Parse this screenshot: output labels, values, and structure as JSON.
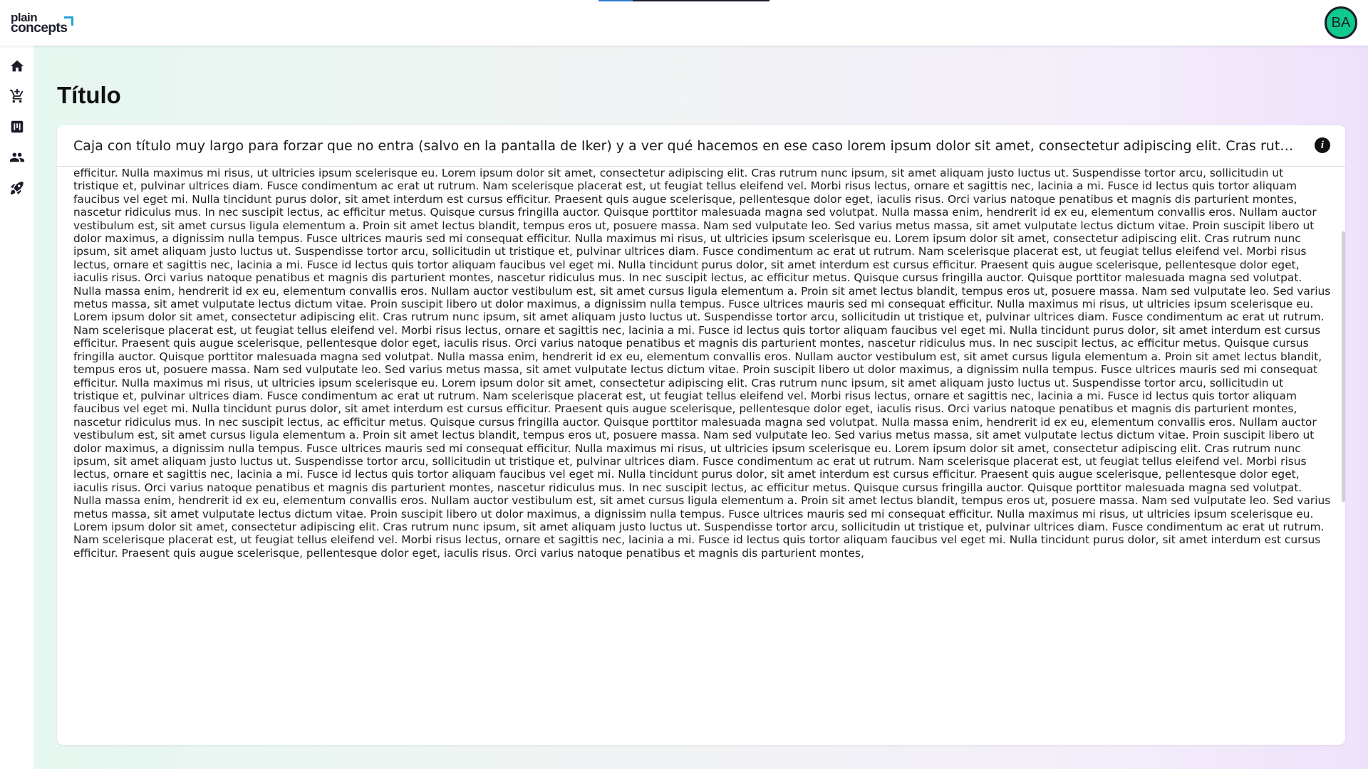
{
  "app": {
    "logo_line1": "plain",
    "logo_line2": "concepts",
    "user_initials": "BA",
    "accent_color": "#10c98c"
  },
  "sidebar": {
    "items": [
      {
        "icon": "home-icon"
      },
      {
        "icon": "cart-add-icon"
      },
      {
        "icon": "board-icon"
      },
      {
        "icon": "people-icon"
      },
      {
        "icon": "rocket-icon"
      }
    ]
  },
  "page": {
    "title": "Título"
  },
  "card": {
    "title": "Caja con título muy largo para forzar que no entra (salvo en la pantalla de Iker) y a ver qué hacemos en ese caso lorem ipsum dolor sit amet, consectetur adipiscing elit. Cras rutrum nunc ipsum, sit amet aliquam justo luctus ut.",
    "info_icon": "info-icon",
    "body": "efficitur. Nulla maximus mi risus, ut ultricies ipsum scelerisque eu. Lorem ipsum dolor sit amet, consectetur adipiscing elit. Cras rutrum nunc ipsum, sit amet aliquam justo luctus ut. Suspendisse tortor arcu, sollicitudin ut tristique et, pulvinar ultrices diam. Fusce condimentum ac erat ut rutrum. Nam scelerisque placerat est, ut feugiat tellus eleifend vel. Morbi risus lectus, ornare et sagittis nec, lacinia a mi. Fusce id lectus quis tortor aliquam faucibus vel eget mi. Nulla tincidunt purus dolor, sit amet interdum est cursus efficitur. Praesent quis augue scelerisque, pellentesque dolor eget, iaculis risus. Orci varius natoque penatibus et magnis dis parturient montes, nascetur ridiculus mus. In nec suscipit lectus, ac efficitur metus. Quisque cursus fringilla auctor. Quisque porttitor malesuada magna sed volutpat. Nulla massa enim, hendrerit id ex eu, elementum convallis eros. Nullam auctor vestibulum est, sit amet cursus ligula elementum a. Proin sit amet lectus blandit, tempus eros ut, posuere massa. Nam sed vulputate leo. Sed varius metus massa, sit amet vulputate lectus dictum vitae. Proin suscipit libero ut dolor maximus, a dignissim nulla tempus. Fusce ultrices mauris sed mi consequat efficitur. Nulla maximus mi risus, ut ultricies ipsum scelerisque eu. Lorem ipsum dolor sit amet, consectetur adipiscing elit. Cras rutrum nunc ipsum, sit amet aliquam justo luctus ut. Suspendisse tortor arcu, sollicitudin ut tristique et, pulvinar ultrices diam. Fusce condimentum ac erat ut rutrum. Nam scelerisque placerat est, ut feugiat tellus eleifend vel. Morbi risus lectus, ornare et sagittis nec, lacinia a mi. Fusce id lectus quis tortor aliquam faucibus vel eget mi. Nulla tincidunt purus dolor, sit amet interdum est cursus efficitur. Praesent quis augue scelerisque, pellentesque dolor eget, iaculis risus. Orci varius natoque penatibus et magnis dis parturient montes, nascetur ridiculus mus. In nec suscipit lectus, ac efficitur metus. Quisque cursus fringilla auctor. Quisque porttitor malesuada magna sed volutpat. Nulla massa enim, hendrerit id ex eu, elementum convallis eros. Nullam auctor vestibulum est, sit amet cursus ligula elementum a. Proin sit amet lectus blandit, tempus eros ut, posuere massa. Nam sed vulputate leo. Sed varius metus massa, sit amet vulputate lectus dictum vitae. Proin suscipit libero ut dolor maximus, a dignissim nulla tempus. Fusce ultrices mauris sed mi consequat efficitur. Nulla maximus mi risus, ut ultricies ipsum scelerisque eu. Lorem ipsum dolor sit amet, consectetur adipiscing elit. Cras rutrum nunc ipsum, sit amet aliquam justo luctus ut. Suspendisse tortor arcu, sollicitudin ut tristique et, pulvinar ultrices diam. Fusce condimentum ac erat ut rutrum. Nam scelerisque placerat est, ut feugiat tellus eleifend vel. Morbi risus lectus, ornare et sagittis nec, lacinia a mi. Fusce id lectus quis tortor aliquam faucibus vel eget mi. Nulla tincidunt purus dolor, sit amet interdum est cursus efficitur. Praesent quis augue scelerisque, pellentesque dolor eget, iaculis risus. Orci varius natoque penatibus et magnis dis parturient montes, nascetur ridiculus mus. In nec suscipit lectus, ac efficitur metus. Quisque cursus fringilla auctor. Quisque porttitor malesuada magna sed volutpat. Nulla massa enim, hendrerit id ex eu, elementum convallis eros. Nullam auctor vestibulum est, sit amet cursus ligula elementum a. Proin sit amet lectus blandit, tempus eros ut, posuere massa. Nam sed vulputate leo. Sed varius metus massa, sit amet vulputate lectus dictum vitae. Proin suscipit libero ut dolor maximus, a dignissim nulla tempus. Fusce ultrices mauris sed mi consequat efficitur. Nulla maximus mi risus, ut ultricies ipsum scelerisque eu. Lorem ipsum dolor sit amet, consectetur adipiscing elit. Cras rutrum nunc ipsum, sit amet aliquam justo luctus ut. Suspendisse tortor arcu, sollicitudin ut tristique et, pulvinar ultrices diam. Fusce condimentum ac erat ut rutrum. Nam scelerisque placerat est, ut feugiat tellus eleifend vel. Morbi risus lectus, ornare et sagittis nec, lacinia a mi. Fusce id lectus quis tortor aliquam faucibus vel eget mi. Nulla tincidunt purus dolor, sit amet interdum est cursus efficitur. Praesent quis augue scelerisque, pellentesque dolor eget, iaculis risus. Orci varius natoque penatibus et magnis dis parturient montes, nascetur ridiculus mus. In nec suscipit lectus, ac efficitur metus. Quisque cursus fringilla auctor. Quisque porttitor malesuada magna sed volutpat. Nulla massa enim, hendrerit id ex eu, elementum convallis eros. Nullam auctor vestibulum est, sit amet cursus ligula elementum a. Proin sit amet lectus blandit, tempus eros ut, posuere massa. Nam sed vulputate leo. Sed varius metus massa, sit amet vulputate lectus dictum vitae. Proin suscipit libero ut dolor maximus, a dignissim nulla tempus. Fusce ultrices mauris sed mi consequat efficitur. Nulla maximus mi risus, ut ultricies ipsum scelerisque eu. Lorem ipsum dolor sit amet, consectetur adipiscing elit. Cras rutrum nunc ipsum, sit amet aliquam justo luctus ut. Suspendisse tortor arcu, sollicitudin ut tristique et, pulvinar ultrices diam. Fusce condimentum ac erat ut rutrum. Nam scelerisque placerat est, ut feugiat tellus eleifend vel. Morbi risus lectus, ornare et sagittis nec, lacinia a mi. Fusce id lectus quis tortor aliquam faucibus vel eget mi. Nulla tincidunt purus dolor, sit amet interdum est cursus efficitur. Praesent quis augue scelerisque, pellentesque dolor eget, iaculis risus. Orci varius natoque penatibus et magnis dis parturient montes, nascetur ridiculus mus. In nec suscipit lectus, ac efficitur metus. Quisque cursus fringilla auctor. Quisque porttitor malesuada magna sed volutpat. Nulla massa enim, hendrerit id ex eu, elementum convallis eros. Nullam auctor vestibulum est, sit amet cursus ligula elementum a. Proin sit amet lectus blandit, tempus eros ut, posuere massa. Nam sed vulputate leo. Sed varius metus massa, sit amet vulputate lectus dictum vitae. Proin suscipit libero ut dolor maximus, a dignissim nulla tempus. Fusce ultrices mauris sed mi consequat efficitur. Nulla maximus mi risus, ut ultricies ipsum scelerisque eu. Lorem ipsum dolor sit amet, consectetur adipiscing elit. Cras rutrum nunc ipsum, sit amet aliquam justo luctus ut. Suspendisse tortor arcu, sollicitudin ut tristique et, pulvinar ultrices diam. Fusce condimentum ac erat ut rutrum. Nam scelerisque placerat est, ut feugiat tellus eleifend vel. Morbi risus lectus, ornare et sagittis nec, lacinia a mi. Fusce id lectus quis tortor aliquam faucibus vel eget mi. Nulla tincidunt purus dolor, sit amet interdum est cursus efficitur. Praesent quis augue scelerisque, pellentesque dolor eget, iaculis risus. Orci varius natoque penatibus et magnis dis parturient montes,"
  }
}
